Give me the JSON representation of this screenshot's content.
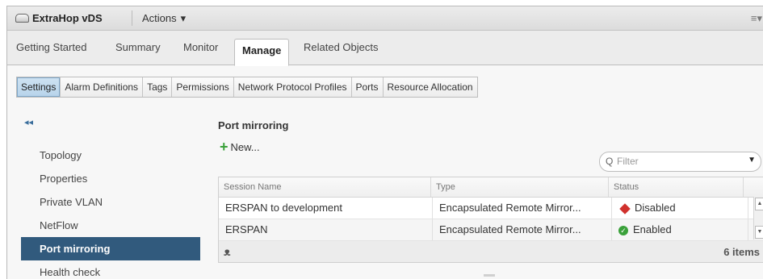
{
  "titlebar": {
    "object_icon": "distributed-switch-icon",
    "object_name": "ExtraHop vDS",
    "actions_label": "Actions",
    "actions_chevron": "▾",
    "menu_icon": "≡▾"
  },
  "primary_tabs": [
    {
      "label": "Getting Started",
      "active": false
    },
    {
      "label": "Summary",
      "active": false
    },
    {
      "label": "Monitor",
      "active": false
    },
    {
      "label": "Manage",
      "active": true
    },
    {
      "label": "Related Objects",
      "active": false
    }
  ],
  "secondary_tabs": [
    {
      "label": "Settings",
      "active": true
    },
    {
      "label": "Alarm Definitions",
      "active": false
    },
    {
      "label": "Tags",
      "active": false
    },
    {
      "label": "Permissions",
      "active": false
    },
    {
      "label": "Network Protocol Profiles",
      "active": false
    },
    {
      "label": "Ports",
      "active": false
    },
    {
      "label": "Resource Allocation",
      "active": false
    }
  ],
  "leftnav": {
    "collapse_label": "◂◂",
    "items": [
      {
        "label": "Topology"
      },
      {
        "label": "Properties"
      },
      {
        "label": "Private VLAN"
      },
      {
        "label": "NetFlow"
      },
      {
        "label": "Port mirroring"
      },
      {
        "label": "Health check"
      }
    ],
    "active_index": 4
  },
  "panel": {
    "title": "Port mirroring",
    "new_label": "New...",
    "filter_placeholder": "Filter",
    "columns": [
      "Session Name",
      "Type",
      "Status"
    ],
    "rows": [
      {
        "name": "ERSPAN to development",
        "type": "Encapsulated Remote Mirror...",
        "status": "Disabled",
        "status_icon": "disabled-icon"
      },
      {
        "name": "ERSPAN",
        "type": "Encapsulated Remote Mirror...",
        "status": "Enabled",
        "status_icon": "enabled-icon"
      }
    ],
    "item_count": "6 items"
  },
  "colors": {
    "active_nav": "#315a7d",
    "active_subtab": "#b7d3ea",
    "disabled": "#d0312d",
    "enabled": "#3aa13a"
  }
}
